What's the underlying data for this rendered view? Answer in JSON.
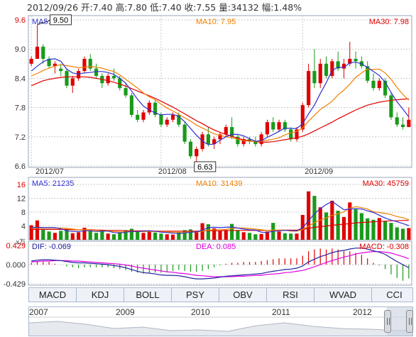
{
  "header": {
    "date": "2012/09/26",
    "open_label": "开:",
    "open": "7.40",
    "high_label": "高:",
    "high": "7.80",
    "low_label": "低:",
    "low": "7.40",
    "close_label": "收:",
    "close": "7.55",
    "volume_label": "量:",
    "volume": "34132",
    "change_label": "幅:",
    "change": "1.48%"
  },
  "colors": {
    "up": "#e00000",
    "down": "#1a9a1a",
    "ma5": "#3030d0",
    "ma10": "#f08000",
    "ma30": "#e00000",
    "grid": "#c8c8c8",
    "dea": "#e000e0",
    "dif": "#2020a0"
  },
  "price_panel": {
    "ma5_label": "MA5: 7.53",
    "ma10_label": "MA10: 7.95",
    "ma30_label": "MA30: 7.98",
    "y_ticks": [
      "9.6",
      "9.0",
      "8.4",
      "7.8",
      "7.2",
      "6.6"
    ],
    "x_labels": [
      "2012/07",
      "2012/08",
      "2012/09"
    ],
    "high_callout": "9.50",
    "low_callout": "6.63"
  },
  "volume_panel": {
    "ma5_label": "MA5: 21235",
    "ma10_label": "MA10: 31439",
    "ma30_label": "MA30: 45759",
    "y_ticks": [
      "16",
      "12",
      "8",
      "4"
    ],
    "unit": "x万"
  },
  "macd_panel": {
    "dif_label": "DIF: -0.069",
    "dea_label": "DEA: 0.085",
    "macd_label": "MACD: -0.308",
    "y_ticks": [
      "0.429",
      "0.000",
      "-0.429"
    ]
  },
  "tabs": [
    "MACD",
    "KDJ",
    "BOLL",
    "PSY",
    "OBV",
    "RSI",
    "WVAD",
    "CCI"
  ],
  "active_tab": "MACD",
  "navigator": {
    "years": [
      "2007",
      "2009",
      "2010",
      "2011",
      "2012"
    ]
  },
  "chart_data": {
    "type": "candlestick",
    "ylim": [
      6.6,
      9.6
    ],
    "candles": [
      [
        8.7,
        8.85,
        8.65,
        8.8
      ],
      [
        8.8,
        9.5,
        8.8,
        9.05
      ],
      [
        9.05,
        9.1,
        8.7,
        8.8
      ],
      [
        8.8,
        8.85,
        8.6,
        8.65
      ],
      [
        8.65,
        8.75,
        8.5,
        8.7
      ],
      [
        8.6,
        8.7,
        8.45,
        8.55
      ],
      [
        8.55,
        8.6,
        8.2,
        8.25
      ],
      [
        8.25,
        8.45,
        8.1,
        8.4
      ],
      [
        8.4,
        8.6,
        8.35,
        8.55
      ],
      [
        8.55,
        8.85,
        8.5,
        8.8
      ],
      [
        8.8,
        8.9,
        8.55,
        8.6
      ],
      [
        8.6,
        8.7,
        8.4,
        8.45
      ],
      [
        8.45,
        8.5,
        8.2,
        8.3
      ],
      [
        8.3,
        8.5,
        8.25,
        8.45
      ],
      [
        8.45,
        8.6,
        8.35,
        8.4
      ],
      [
        8.4,
        8.45,
        8.15,
        8.2
      ],
      [
        8.2,
        8.3,
        8.0,
        8.05
      ],
      [
        8.05,
        8.1,
        7.6,
        7.65
      ],
      [
        7.65,
        7.75,
        7.5,
        7.55
      ],
      [
        7.55,
        7.75,
        7.5,
        7.7
      ],
      [
        7.7,
        7.95,
        7.65,
        7.9
      ],
      [
        7.9,
        7.95,
        7.6,
        7.65
      ],
      [
        7.65,
        7.7,
        7.4,
        7.45
      ],
      [
        7.45,
        7.6,
        7.4,
        7.55
      ],
      [
        7.55,
        7.7,
        7.5,
        7.65
      ],
      [
        7.65,
        7.7,
        7.4,
        7.45
      ],
      [
        7.45,
        7.5,
        7.05,
        7.1
      ],
      [
        7.1,
        7.15,
        6.75,
        6.8
      ],
      [
        6.8,
        7.0,
        6.63,
        6.95
      ],
      [
        6.95,
        7.3,
        6.9,
        7.25
      ],
      [
        7.25,
        7.4,
        7.0,
        7.05
      ],
      [
        7.05,
        7.2,
        6.95,
        7.15
      ],
      [
        7.15,
        7.3,
        7.05,
        7.25
      ],
      [
        7.25,
        7.45,
        7.2,
        7.4
      ],
      [
        7.4,
        7.6,
        7.15,
        7.2
      ],
      [
        7.2,
        7.25,
        7.0,
        7.05
      ],
      [
        7.05,
        7.2,
        7.0,
        7.15
      ],
      [
        7.15,
        7.2,
        7.05,
        7.1
      ],
      [
        7.1,
        7.2,
        7.0,
        7.05
      ],
      [
        7.05,
        7.3,
        7.0,
        7.25
      ],
      [
        7.25,
        7.55,
        7.2,
        7.5
      ],
      [
        7.5,
        7.6,
        7.3,
        7.35
      ],
      [
        7.35,
        7.55,
        7.3,
        7.5
      ],
      [
        7.5,
        7.55,
        7.3,
        7.35
      ],
      [
        7.35,
        7.4,
        7.1,
        7.15
      ],
      [
        7.15,
        7.4,
        7.1,
        7.35
      ],
      [
        7.35,
        7.9,
        7.3,
        7.85
      ],
      [
        7.85,
        8.7,
        7.8,
        8.55
      ],
      [
        8.55,
        9.0,
        8.2,
        8.3
      ],
      [
        8.3,
        8.8,
        8.2,
        8.7
      ],
      [
        8.7,
        8.85,
        8.4,
        8.45
      ],
      [
        8.45,
        8.8,
        8.4,
        8.75
      ],
      [
        8.75,
        8.95,
        8.55,
        8.6
      ],
      [
        8.6,
        8.8,
        8.4,
        8.7
      ],
      [
        8.7,
        9.15,
        8.65,
        8.8
      ],
      [
        8.8,
        8.95,
        8.6,
        8.75
      ],
      [
        8.75,
        8.85,
        8.6,
        8.65
      ],
      [
        8.65,
        8.75,
        8.3,
        8.35
      ],
      [
        8.35,
        8.5,
        8.15,
        8.2
      ],
      [
        8.2,
        8.4,
        8.15,
        8.35
      ],
      [
        8.35,
        8.4,
        8.0,
        8.05
      ],
      [
        8.05,
        8.1,
        7.55,
        7.6
      ],
      [
        7.6,
        7.7,
        7.4,
        7.45
      ],
      [
        7.45,
        7.6,
        7.35,
        7.4
      ],
      [
        7.4,
        7.8,
        7.4,
        7.55
      ]
    ],
    "ma5": [
      8.55,
      8.65,
      8.74,
      8.79,
      8.8,
      8.75,
      8.59,
      8.51,
      8.49,
      8.51,
      8.52,
      8.54,
      8.54,
      8.52,
      8.48,
      8.4,
      8.3,
      8.14,
      7.97,
      7.83,
      7.75,
      7.69,
      7.65,
      7.66,
      7.66,
      7.62,
      7.51,
      7.37,
      7.23,
      7.11,
      7.04,
      7.05,
      7.13,
      7.2,
      7.25,
      7.25,
      7.22,
      7.16,
      7.11,
      7.12,
      7.19,
      7.25,
      7.31,
      7.38,
      7.37,
      7.37,
      7.47,
      7.67,
      7.85,
      8.09,
      8.31,
      8.56,
      8.63,
      8.62,
      8.72,
      8.73,
      8.7,
      8.62,
      8.54,
      8.46,
      8.32,
      8.11,
      7.92,
      7.77,
      7.61
    ],
    "ma10": [
      8.45,
      8.5,
      8.56,
      8.61,
      8.65,
      8.68,
      8.66,
      8.64,
      8.62,
      8.63,
      8.64,
      8.63,
      8.61,
      8.57,
      8.54,
      8.47,
      8.38,
      8.29,
      8.2,
      8.1,
      8.02,
      7.96,
      7.87,
      7.79,
      7.73,
      7.66,
      7.59,
      7.52,
      7.44,
      7.38,
      7.32,
      7.26,
      7.23,
      7.2,
      7.18,
      7.15,
      7.12,
      7.11,
      7.1,
      7.11,
      7.13,
      7.15,
      7.18,
      7.24,
      7.28,
      7.31,
      7.38,
      7.52,
      7.64,
      7.76,
      7.84,
      7.93,
      8.06,
      8.16,
      8.28,
      8.42,
      8.51,
      8.59,
      8.58,
      8.59,
      8.51,
      8.38,
      8.21,
      8.07,
      7.95
    ],
    "ma30": [
      8.25,
      8.3,
      8.35,
      8.38,
      8.4,
      8.42,
      8.43,
      8.43,
      8.43,
      8.43,
      8.42,
      8.4,
      8.38,
      8.35,
      8.32,
      8.28,
      8.24,
      8.19,
      8.14,
      8.09,
      8.04,
      7.99,
      7.93,
      7.87,
      7.81,
      7.74,
      7.67,
      7.6,
      7.53,
      7.47,
      7.4,
      7.34,
      7.29,
      7.25,
      7.21,
      7.17,
      7.14,
      7.12,
      7.1,
      7.09,
      7.09,
      7.1,
      7.12,
      7.14,
      7.16,
      7.18,
      7.21,
      7.26,
      7.32,
      7.38,
      7.44,
      7.5,
      7.57,
      7.63,
      7.69,
      7.75,
      7.8,
      7.85,
      7.88,
      7.91,
      7.93,
      7.95,
      7.96,
      7.97,
      7.98
    ],
    "volume": {
      "ylim": [
        0,
        16
      ],
      "values": [
        4.2,
        5.6,
        3.1,
        2.4,
        2.0,
        2.6,
        2.9,
        1.9,
        2.2,
        3.5,
        2.5,
        2.0,
        2.6,
        1.8,
        1.6,
        2.2,
        2.8,
        3.2,
        2.4,
        2.0,
        2.6,
        2.1,
        1.8,
        1.6,
        1.5,
        2.2,
        2.8,
        3.0,
        2.2,
        4.8,
        4.5,
        3.3,
        2.6,
        2.8,
        4.6,
        2.8,
        2.2,
        2.0,
        1.6,
        1.7,
        2.4,
        4.9,
        2.4,
        1.9,
        1.8,
        1.8,
        7.2,
        14.0,
        12.7,
        9.4,
        7.9,
        11.3,
        8.4,
        6.6,
        10.8,
        8.8,
        7.7,
        6.2,
        5.8,
        6.3,
        5.4,
        4.9,
        3.6,
        3.2,
        3.4
      ],
      "ma5": [
        3.5,
        3.6,
        3.5,
        3.5,
        3.5,
        3.2,
        2.6,
        2.4,
        2.4,
        2.6,
        2.6,
        2.4,
        2.5,
        2.5,
        2.1,
        2.0,
        2.2,
        2.4,
        2.4,
        2.5,
        2.6,
        2.5,
        2.2,
        2.1,
        1.9,
        1.8,
        2.0,
        2.2,
        2.3,
        2.8,
        3.5,
        3.6,
        3.5,
        3.6,
        3.7,
        3.4,
        3.1,
        2.9,
        2.8,
        2.2,
        2.1,
        2.5,
        2.6,
        2.7,
        2.7,
        2.6,
        3.5,
        5.5,
        7.5,
        9.0,
        10.2,
        11.1,
        9.9,
        8.7,
        8.9,
        9.0,
        8.9,
        8.4,
        7.9,
        7.1,
        6.3,
        5.7,
        5.2,
        4.7,
        4.1
      ],
      "ma10": [
        3.3,
        3.4,
        3.4,
        3.4,
        3.4,
        3.4,
        3.3,
        3.1,
        2.9,
        2.9,
        2.8,
        2.7,
        2.6,
        2.6,
        2.4,
        2.3,
        2.3,
        2.4,
        2.4,
        2.4,
        2.4,
        2.4,
        2.3,
        2.3,
        2.2,
        2.2,
        2.2,
        2.3,
        2.2,
        2.5,
        2.8,
        2.9,
        2.9,
        3.0,
        3.3,
        3.4,
        3.4,
        3.3,
        3.1,
        2.9,
        2.7,
        2.8,
        2.8,
        2.8,
        2.5,
        2.5,
        3.0,
        3.9,
        5.0,
        5.7,
        6.3,
        7.1,
        7.5,
        8.1,
        9.1,
        9.6,
        9.3,
        8.9,
        8.1,
        7.9,
        7.6,
        7.3,
        6.7,
        6.4,
        5.8
      ],
      "ma30": [
        3.0,
        3.0,
        3.0,
        3.0,
        3.0,
        3.0,
        3.0,
        2.9,
        2.9,
        2.9,
        2.9,
        2.8,
        2.8,
        2.7,
        2.7,
        2.7,
        2.6,
        2.6,
        2.6,
        2.6,
        2.6,
        2.5,
        2.5,
        2.5,
        2.5,
        2.5,
        2.5,
        2.5,
        2.5,
        2.6,
        2.6,
        2.6,
        2.6,
        2.7,
        2.7,
        2.7,
        2.7,
        2.7,
        2.7,
        2.7,
        2.7,
        2.7,
        2.8,
        2.8,
        2.8,
        2.8,
        3.0,
        3.3,
        3.6,
        3.8,
        4.0,
        4.2,
        4.4,
        4.5,
        4.7,
        4.9,
        5.0,
        5.1,
        5.2,
        5.3,
        5.4,
        5.5,
        5.5,
        5.6,
        5.6
      ]
    },
    "macd": {
      "ylim": [
        -0.5,
        0.5
      ],
      "dif": [
        0.08,
        0.1,
        0.11,
        0.11,
        0.1,
        0.09,
        0.07,
        0.05,
        0.04,
        0.04,
        0.03,
        0.02,
        0.01,
        0.0,
        -0.02,
        -0.04,
        -0.07,
        -0.11,
        -0.15,
        -0.18,
        -0.19,
        -0.21,
        -0.23,
        -0.24,
        -0.24,
        -0.25,
        -0.27,
        -0.3,
        -0.32,
        -0.32,
        -0.31,
        -0.3,
        -0.28,
        -0.26,
        -0.25,
        -0.24,
        -0.23,
        -0.22,
        -0.21,
        -0.2,
        -0.17,
        -0.15,
        -0.13,
        -0.11,
        -0.1,
        -0.08,
        -0.03,
        0.06,
        0.12,
        0.18,
        0.22,
        0.27,
        0.3,
        0.32,
        0.35,
        0.37,
        0.37,
        0.35,
        0.31,
        0.28,
        0.23,
        0.15,
        0.07,
        0.0,
        -0.07
      ],
      "dea": [
        0.06,
        0.07,
        0.08,
        0.08,
        0.09,
        0.09,
        0.09,
        0.08,
        0.08,
        0.07,
        0.06,
        0.05,
        0.04,
        0.03,
        0.02,
        0.01,
        -0.01,
        -0.03,
        -0.06,
        -0.08,
        -0.1,
        -0.12,
        -0.14,
        -0.16,
        -0.17,
        -0.19,
        -0.2,
        -0.22,
        -0.24,
        -0.25,
        -0.26,
        -0.27,
        -0.27,
        -0.27,
        -0.27,
        -0.26,
        -0.26,
        -0.25,
        -0.24,
        -0.24,
        -0.22,
        -0.21,
        -0.2,
        -0.18,
        -0.17,
        -0.15,
        -0.13,
        -0.09,
        -0.05,
        0.0,
        0.05,
        0.09,
        0.13,
        0.17,
        0.2,
        0.24,
        0.26,
        0.28,
        0.29,
        0.29,
        0.28,
        0.26,
        0.22,
        0.18,
        0.13
      ],
      "hist": [
        0.04,
        0.06,
        0.06,
        0.06,
        0.02,
        0.0,
        -0.04,
        -0.06,
        -0.08,
        -0.06,
        -0.06,
        -0.06,
        -0.06,
        -0.06,
        -0.08,
        -0.1,
        -0.12,
        -0.16,
        -0.18,
        -0.2,
        -0.18,
        -0.18,
        -0.18,
        -0.16,
        -0.14,
        -0.12,
        -0.14,
        -0.16,
        -0.16,
        -0.14,
        -0.1,
        -0.06,
        -0.02,
        0.02,
        0.04,
        0.04,
        0.06,
        0.06,
        0.06,
        0.08,
        0.1,
        0.12,
        0.14,
        0.14,
        0.14,
        0.14,
        0.2,
        0.3,
        0.34,
        0.36,
        0.34,
        0.36,
        0.34,
        0.3,
        0.3,
        0.26,
        0.22,
        0.14,
        0.04,
        -0.02,
        -0.1,
        -0.22,
        -0.3,
        -0.36,
        -0.31
      ]
    }
  }
}
